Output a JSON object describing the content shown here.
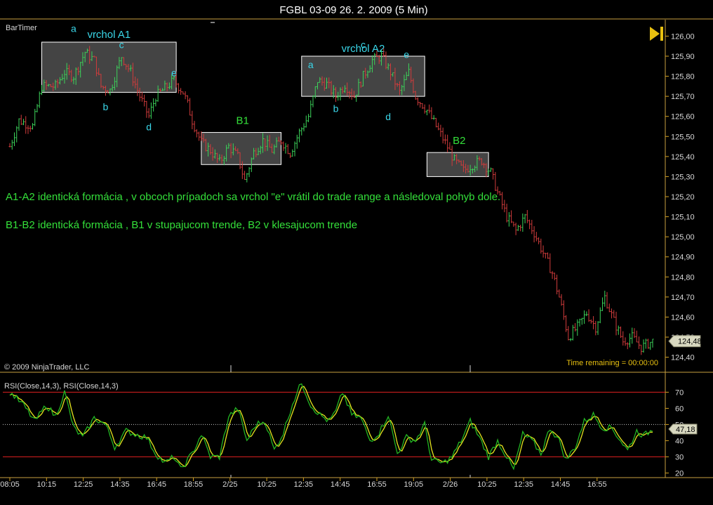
{
  "window": {
    "title": "FGBL 03-09  26. 2. 2009 (5 Min)"
  },
  "indicator_label": "BarTimer",
  "copyright": "© 2009 NinjaTrader, LLC",
  "time_remaining": "Time remaining = 00:00:00",
  "current_price_label": "124,48",
  "rsi_value_label": "47,18",
  "rsi_label": "RSI(Close,14,3), RSI(Close,14,3)",
  "colors": {
    "up_bar": "#3cd25a",
    "down_bar": "#d23c3c",
    "axis": "#d4a020",
    "annotation": "#34e03a",
    "point_label": "#3ad6e8",
    "rsi_line": "#22b522",
    "rsi_signal": "#e6e61e",
    "rsi_level": "#e02020",
    "price_badge": "#d8d8c0",
    "play_icon": "#e8c010"
  },
  "annotations": {
    "line1": "A1-A2 identická formácia , v obcoch prípadoch sa vrchol \"e\" vrátil do trade range a následoval pohyb dole.",
    "line2": "B1-B2 identická formácia , B1 v stupajucom trende, B2 v klesajucom trende"
  },
  "chart_data": [
    {
      "type": "candlestick",
      "title": "FGBL 03-09  26. 2. 2009 (5 Min)",
      "ylim": [
        124.36,
        126.04
      ],
      "y_ticks": [
        "126,00",
        "125,90",
        "125,80",
        "125,70",
        "125,60",
        "125,50",
        "125,40",
        "125,30",
        "125,20",
        "125,10",
        "125,00",
        "124,90",
        "124,80",
        "124,70",
        "124,60",
        "124,50",
        "124,40"
      ],
      "y_tick_values": [
        126.0,
        125.9,
        125.8,
        125.7,
        125.6,
        125.5,
        125.4,
        125.3,
        125.2,
        125.1,
        125.0,
        124.9,
        124.8,
        124.7,
        124.6,
        124.5,
        124.4
      ],
      "x_ticks": [
        "08:05",
        "10:15",
        "12:25",
        "14:35",
        "16:45",
        "18:55",
        "2/25",
        "10:25",
        "12:35",
        "14:45",
        "16:55",
        "19:05",
        "2/26",
        "10:25",
        "12:35",
        "14:45",
        "16:55"
      ],
      "path_points": [
        [
          0,
          125.45
        ],
        [
          4,
          125.58
        ],
        [
          10,
          125.55
        ],
        [
          14,
          125.75
        ],
        [
          20,
          125.75
        ],
        [
          24,
          125.82
        ],
        [
          28,
          125.8
        ],
        [
          33,
          125.92
        ],
        [
          37,
          125.88
        ],
        [
          40,
          125.75
        ],
        [
          44,
          125.73
        ],
        [
          49,
          125.9
        ],
        [
          53,
          125.82
        ],
        [
          57,
          125.7
        ],
        [
          61,
          125.6
        ],
        [
          64,
          125.7
        ],
        [
          68,
          125.74
        ],
        [
          72,
          125.78
        ],
        [
          76,
          125.72
        ],
        [
          78,
          125.66
        ],
        [
          80,
          125.58
        ],
        [
          84,
          125.47
        ],
        [
          88,
          125.43
        ],
        [
          92,
          125.37
        ],
        [
          96,
          125.45
        ],
        [
          100,
          125.4
        ],
        [
          103,
          125.28
        ],
        [
          107,
          125.42
        ],
        [
          111,
          125.48
        ],
        [
          115,
          125.43
        ],
        [
          119,
          125.48
        ],
        [
          123,
          125.42
        ],
        [
          127,
          125.52
        ],
        [
          131,
          125.6
        ],
        [
          135,
          125.78
        ],
        [
          139,
          125.76
        ],
        [
          143,
          125.7
        ],
        [
          147,
          125.76
        ],
        [
          151,
          125.7
        ],
        [
          155,
          125.8
        ],
        [
          159,
          125.88
        ],
        [
          163,
          125.9
        ],
        [
          167,
          125.82
        ],
        [
          171,
          125.72
        ],
        [
          175,
          125.82
        ],
        [
          178,
          125.7
        ],
        [
          183,
          125.63
        ],
        [
          187,
          125.55
        ],
        [
          191,
          125.47
        ],
        [
          195,
          125.38
        ],
        [
          199,
          125.33
        ],
        [
          203,
          125.36
        ],
        [
          207,
          125.38
        ],
        [
          211,
          125.32
        ],
        [
          214,
          125.22
        ],
        [
          218,
          125.1
        ],
        [
          222,
          125.03
        ],
        [
          226,
          125.1
        ],
        [
          230,
          125.02
        ],
        [
          234,
          124.92
        ],
        [
          238,
          124.82
        ],
        [
          241,
          124.7
        ],
        [
          245,
          124.5
        ],
        [
          249,
          124.55
        ],
        [
          253,
          124.62
        ],
        [
          257,
          124.55
        ],
        [
          261,
          124.7
        ],
        [
          265,
          124.58
        ],
        [
          269,
          124.48
        ],
        [
          273,
          124.5
        ],
        [
          277,
          124.45
        ],
        [
          282,
          124.48
        ]
      ],
      "indicators": {
        "current_price": 124.48
      }
    },
    {
      "type": "line",
      "title": "RSI(Close,14,3), RSI(Close,14,3)",
      "ylim": [
        18,
        78
      ],
      "y_ticks": [
        "70",
        "60",
        "50",
        "40",
        "30",
        "20"
      ],
      "y_tick_values": [
        70,
        60,
        50,
        40,
        30,
        20
      ],
      "levels": [
        70,
        30
      ],
      "midline": 50,
      "path_points": [
        [
          0,
          70
        ],
        [
          6,
          62
        ],
        [
          11,
          52
        ],
        [
          16,
          62
        ],
        [
          20,
          55
        ],
        [
          24,
          70
        ],
        [
          28,
          48
        ],
        [
          32,
          42
        ],
        [
          37,
          54
        ],
        [
          42,
          50
        ],
        [
          46,
          36
        ],
        [
          51,
          46
        ],
        [
          55,
          44
        ],
        [
          60,
          42
        ],
        [
          64,
          32
        ],
        [
          68,
          26
        ],
        [
          72,
          30
        ],
        [
          75,
          22
        ],
        [
          80,
          32
        ],
        [
          84,
          44
        ],
        [
          88,
          30
        ],
        [
          92,
          30
        ],
        [
          96,
          55
        ],
        [
          100,
          60
        ],
        [
          104,
          40
        ],
        [
          108,
          50
        ],
        [
          112,
          52
        ],
        [
          116,
          34
        ],
        [
          120,
          45
        ],
        [
          124,
          63
        ],
        [
          128,
          76
        ],
        [
          132,
          62
        ],
        [
          136,
          56
        ],
        [
          140,
          52
        ],
        [
          143,
          58
        ],
        [
          146,
          70
        ],
        [
          150,
          56
        ],
        [
          154,
          54
        ],
        [
          158,
          40
        ],
        [
          162,
          45
        ],
        [
          166,
          56
        ],
        [
          170,
          32
        ],
        [
          174,
          42
        ],
        [
          178,
          40
        ],
        [
          182,
          50
        ],
        [
          185,
          28
        ],
        [
          190,
          26
        ],
        [
          194,
          30
        ],
        [
          198,
          40
        ],
        [
          202,
          52
        ],
        [
          206,
          42
        ],
        [
          210,
          30
        ],
        [
          214,
          40
        ],
        [
          218,
          30
        ],
        [
          221,
          22
        ],
        [
          225,
          44
        ],
        [
          229,
          40
        ],
        [
          233,
          32
        ],
        [
          237,
          48
        ],
        [
          241,
          40
        ],
        [
          244,
          28
        ],
        [
          248,
          36
        ],
        [
          252,
          52
        ],
        [
          256,
          56
        ],
        [
          260,
          48
        ],
        [
          264,
          48
        ],
        [
          268,
          40
        ],
        [
          271,
          34
        ],
        [
          275,
          46
        ],
        [
          278,
          43
        ],
        [
          282,
          47
        ]
      ],
      "indicators": {
        "current_value": 47.18
      }
    }
  ],
  "regions": [
    {
      "name": "vrchol A1",
      "label": "vrchol A1",
      "bar_start": 14,
      "bar_end": 73,
      "price_low": 125.72,
      "price_high": 125.97
    },
    {
      "name": "B1",
      "label": "B1",
      "bar_start": 84,
      "bar_end": 119,
      "price_low": 125.36,
      "price_high": 125.52
    },
    {
      "name": "vrchol A2",
      "label": "vrchol A2",
      "bar_start": 128,
      "bar_end": 182,
      "price_low": 125.7,
      "price_high": 125.9
    },
    {
      "name": "B2",
      "label": "B2",
      "bar_start": 183,
      "bar_end": 210,
      "price_low": 125.3,
      "price_high": 125.42
    }
  ],
  "point_labels": [
    {
      "text": "a",
      "bar": 28,
      "price": 126.0,
      "pos": "above"
    },
    {
      "text": "b",
      "bar": 42,
      "price": 125.68,
      "pos": "below"
    },
    {
      "text": "c",
      "bar": 49,
      "price": 125.92,
      "pos": "above"
    },
    {
      "text": "d",
      "bar": 61,
      "price": 125.58,
      "pos": "below"
    },
    {
      "text": "e",
      "bar": 72,
      "price": 125.78,
      "pos": "above"
    },
    {
      "text": "a",
      "bar": 132,
      "price": 125.82,
      "pos": "above"
    },
    {
      "text": "b",
      "bar": 143,
      "price": 125.67,
      "pos": "below"
    },
    {
      "text": "c",
      "bar": 155,
      "price": 125.92,
      "pos": "above"
    },
    {
      "text": "d",
      "bar": 166,
      "price": 125.63,
      "pos": "below"
    },
    {
      "text": "e",
      "bar": 174,
      "price": 125.87,
      "pos": "above"
    }
  ]
}
